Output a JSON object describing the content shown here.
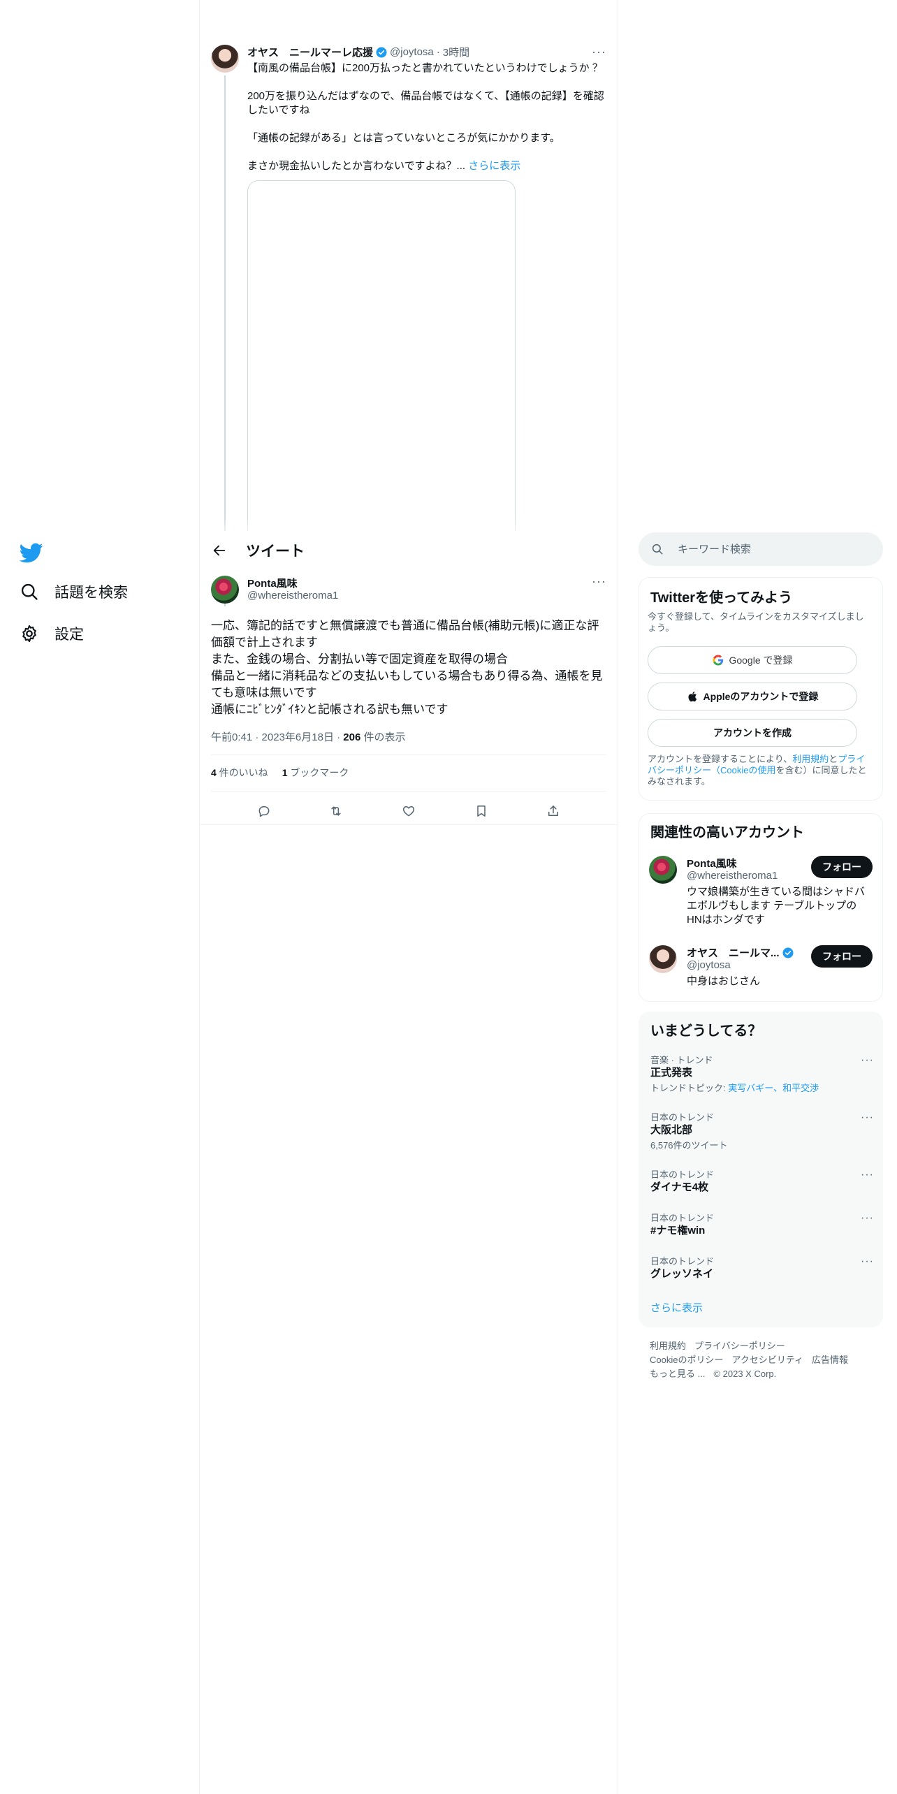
{
  "nav": {
    "items": [
      {
        "label": "話題を検索"
      },
      {
        "label": "設定"
      }
    ]
  },
  "parent_tweet": {
    "name": "オヤス　ニールマーレ応援",
    "handle": "@joytosa",
    "dot": "·",
    "time": "3時間",
    "paragraphs": [
      "【南風の備品台帳】に200万払ったと書かれていたというわけでしょうか ？",
      "200万を振り込んだはずなので、備品台帳ではなくて、【通帳の記録】を確認したいですね",
      "「通帳の記録がある」とは言っていないところが気にかかります。",
      "まさか現金払いしたとか言わないですよね？..."
    ],
    "show_more": "さらに表示"
  },
  "header": {
    "title": "ツイート"
  },
  "tweet": {
    "name": "Ponta風味",
    "handle": "@whereistheroma1",
    "lines": [
      "一応、簿記的話ですと無償譲渡でも普通に備品台帳(補助元帳)に適正な評価額で計上されます",
      "また、金銭の場合、分割払い等で固定資産を取得の場合",
      "備品と一緒に消耗品などの支払いもしている場合もあり得る為、通帳を見ても意味は無いです",
      "通帳にﾆﾋﾞﾋﾝﾀﾞｲｷﾝと記帳される訳も無いです"
    ],
    "time": "午前0:41",
    "date": "2023年6月18日",
    "views_count": "206",
    "views_label": " 件の表示",
    "meta_dot": " · ",
    "likes_count": "4",
    "likes_label": " 件のいいね",
    "bookmarks_count": "1",
    "bookmarks_label": " ブックマーク"
  },
  "search": {
    "placeholder": "キーワード検索"
  },
  "signup": {
    "title": "Twitterを使ってみよう",
    "description": "今すぐ登録して、タイムラインをカスタマイズしましょう。",
    "google_button": "Google で登録",
    "apple_button": "Appleのアカウントで登録",
    "create_button": "アカウントを作成",
    "legal_pre": "アカウントを登録することにより、",
    "legal_terms": "利用規約",
    "legal_and": "と",
    "legal_privacy": "プライバシーポリシー（Cookieの使用",
    "legal_post": "を含む）に同意したとみなされます。"
  },
  "related": {
    "title": "関連性の高いアカウント",
    "accounts": [
      {
        "name": "Ponta風味",
        "handle": "@whereistheroma1",
        "bio": "ウマ娘構築が生きている間はシャドバエボルヴもします テーブルトップのHNはホンダです",
        "follow": "フォロー"
      },
      {
        "name": "オヤス　ニールマ...",
        "handle": "@joytosa",
        "bio": "中身はおじさん",
        "follow": "フォロー"
      }
    ]
  },
  "trends": {
    "title": "いまどうしてる？",
    "items": [
      {
        "context": "音楽 · トレンド",
        "name": "正式発表",
        "sub_prefix": "トレンドトピック: ",
        "sub_link": "実写バギー、和平交渉"
      },
      {
        "context": "日本のトレンド",
        "name": "大阪北部",
        "sub": "6,576件のツイート"
      },
      {
        "context": "日本のトレンド",
        "name": "ダイナモ4枚"
      },
      {
        "context": "日本のトレンド",
        "name": "#ナモ権win"
      },
      {
        "context": "日本のトレンド",
        "name": "グレッソネイ"
      }
    ],
    "show_more": "さらに表示"
  },
  "footer": {
    "links": [
      "利用規約",
      "プライバシーポリシー",
      "Cookieのポリシー",
      "アクセシビリティ",
      "広告情報",
      "もっと見る ..."
    ],
    "copyright": "© 2023 X Corp."
  },
  "colors": {
    "accent": "#1d9bf0",
    "text": "#0f1419",
    "muted": "#536471",
    "border": "#eff3f4"
  },
  "icons": [
    "twitter-logo-icon",
    "search-icon",
    "gear-icon",
    "verified-badge-icon",
    "back-arrow-icon",
    "reply-icon",
    "retweet-icon",
    "like-icon",
    "bookmark-icon",
    "share-icon",
    "google-icon",
    "apple-icon",
    "more-icon"
  ]
}
